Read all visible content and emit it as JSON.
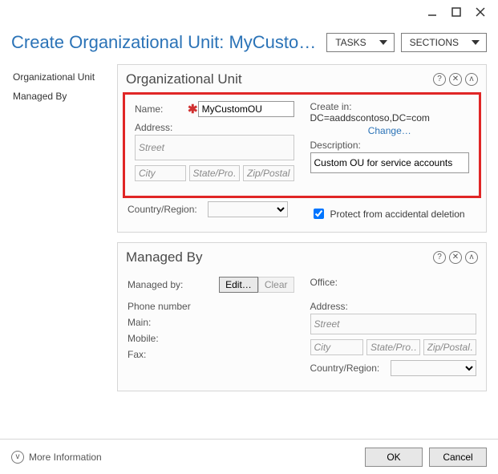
{
  "header": {
    "title": "Create Organizational Unit: MyCusto…",
    "tasks": "TASKS",
    "sections": "SECTIONS"
  },
  "nav": {
    "items": [
      "Organizational Unit",
      "Managed By"
    ]
  },
  "ou_panel": {
    "title": "Organizational Unit",
    "name_label": "Name:",
    "name_value": "MyCustomOU",
    "address_label": "Address:",
    "street_ph": "Street",
    "city_ph": "City",
    "state_ph": "State/Pro…",
    "zip_ph": "Zip/Postal…",
    "country_label": "Country/Region:",
    "create_in_label": "Create in:",
    "create_in_value": "DC=aaddscontoso,DC=com",
    "change_link": "Change…",
    "description_label": "Description:",
    "description_value": "Custom OU for service accounts",
    "protect_label": "Protect from accidental deletion"
  },
  "mb_panel": {
    "title": "Managed By",
    "managed_by_label": "Managed by:",
    "edit_btn": "Edit…",
    "clear_btn": "Clear",
    "phone_label": "Phone number",
    "main_label": "Main:",
    "mobile_label": "Mobile:",
    "fax_label": "Fax:",
    "office_label": "Office:",
    "address_label": "Address:",
    "street_ph": "Street",
    "city_ph": "City",
    "state_ph": "State/Pro…",
    "zip_ph": "Zip/Postal…",
    "country_label": "Country/Region:"
  },
  "footer": {
    "more": "More Information",
    "ok": "OK",
    "cancel": "Cancel"
  }
}
